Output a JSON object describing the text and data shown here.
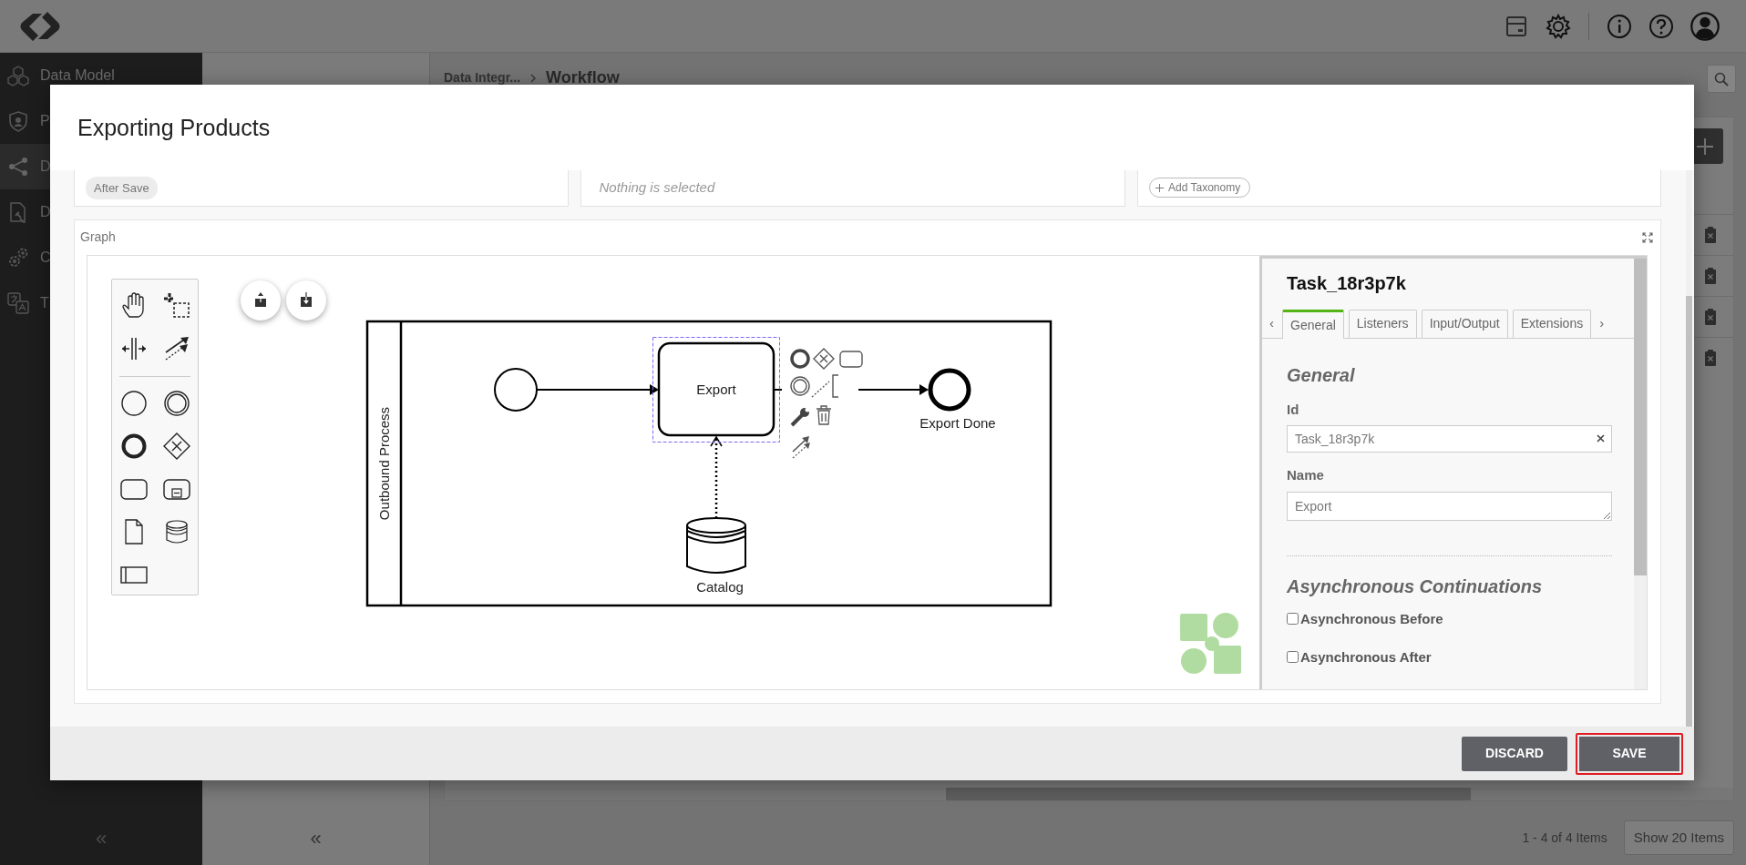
{
  "sidebar": {
    "items": [
      {
        "label": "Data Model",
        "selected": false
      },
      {
        "label": "P",
        "selected": false
      },
      {
        "label": "D",
        "selected": true
      },
      {
        "label": "D",
        "selected": false
      },
      {
        "label": "C",
        "selected": false
      },
      {
        "label": "T",
        "selected": false
      }
    ],
    "collapse": "«"
  },
  "secondary_panel": {
    "collapse": "«"
  },
  "breadcrumb": [
    "Data Integr...",
    "Workflow"
  ],
  "pager": {
    "summary": "1 - 4 of 4 Items",
    "page_size": "Show 20 Items"
  },
  "modal": {
    "title": "Exporting Products",
    "cards": [
      {
        "kind": "chip",
        "text": "After Save"
      },
      {
        "kind": "empty",
        "text": "Nothing is selected"
      },
      {
        "kind": "add",
        "text": "Add Taxonomy"
      }
    ],
    "graph": {
      "label": "Graph",
      "diagram": {
        "pool": "Outbound Process",
        "elements": [
          {
            "kind": "start-event"
          },
          {
            "kind": "task",
            "label": "Export",
            "selected": true
          },
          {
            "kind": "end-event",
            "label": "Export Done"
          },
          {
            "kind": "data-store",
            "label": "Catalog"
          }
        ]
      },
      "properties": {
        "title": "Task_18r3p7k",
        "scroll_left": "‹",
        "scroll_right": "›",
        "tabs": [
          {
            "label": "General",
            "selected": true
          },
          {
            "label": "Listeners",
            "selected": false
          },
          {
            "label": "Input/Output",
            "selected": false
          },
          {
            "label": "Extensions",
            "selected": false
          }
        ],
        "section": "General",
        "fields": [
          {
            "kind": "input",
            "label": "Id",
            "value": "Task_18r3p7k"
          },
          {
            "kind": "textarea",
            "label": "Name",
            "value": "Export"
          }
        ],
        "async": {
          "heading": "Asynchronous Continuations",
          "options": [
            {
              "label": "Asynchronous Before",
              "checked": false
            },
            {
              "label": "Asynchronous After",
              "checked": false
            }
          ]
        }
      }
    },
    "buttons": [
      {
        "label": "DISCARD",
        "focused": false
      },
      {
        "label": "SAVE",
        "focused": true
      }
    ]
  }
}
